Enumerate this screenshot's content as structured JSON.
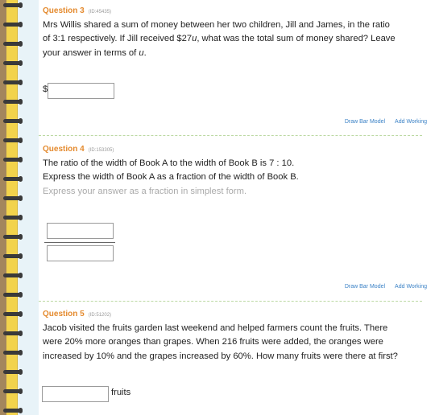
{
  "q3": {
    "label": "Question 3",
    "id": "(ID:45435)",
    "lines": [
      "Mrs Willis shared a sum of money between her two children, Jill and James, in the ratio",
      "of 3:1 respectively. If Jill received $27u, what was the total sum of money shared? Leave",
      "your answer in terms of u."
    ],
    "currency": "$",
    "draw_bar_model": "Draw Bar Model",
    "add_working": "Add Working"
  },
  "q4": {
    "label": "Question 4",
    "id": "(ID:153305)",
    "lines": [
      "The ratio of the width of Book A to the width of Book B is 7 : 10.",
      "Express the width of Book A as a fraction of the width of Book B."
    ],
    "hint": "Express your answer as a fraction in simplest form.",
    "draw_bar_model": "Draw Bar Model",
    "add_working": "Add Working"
  },
  "q5": {
    "label": "Question 5",
    "id": "(ID:51202)",
    "lines": [
      "Jacob visited the fruits garden last weekend and helped farmers count the fruits. There",
      "were 20% more oranges than grapes. When 216 fruits were added, the oranges were",
      "increased by 10% and the grapes increased by 60%. How many fruits were there at first?"
    ],
    "unit": "fruits"
  }
}
